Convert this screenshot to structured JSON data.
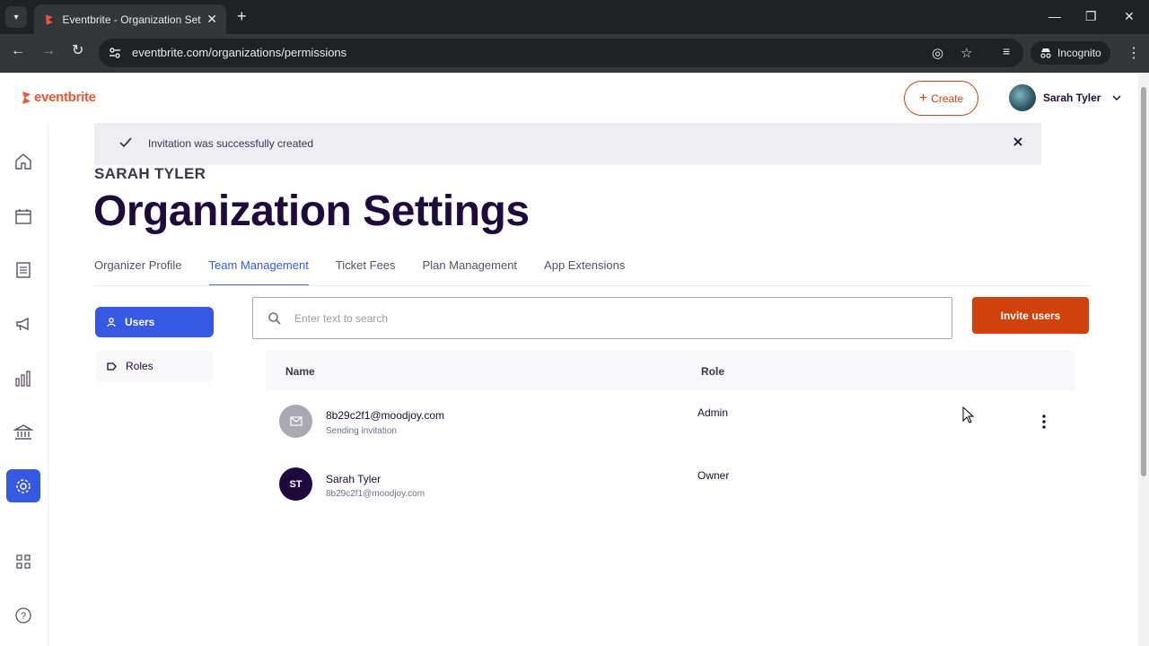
{
  "browser": {
    "tab_title": "Eventbrite - Organization Settings",
    "url": "eventbrite.com/organizations/permissions",
    "incognito_label": "Incognito"
  },
  "header": {
    "logo_text": "eventbrite",
    "create_label": "Create",
    "user_name": "Sarah Tyler"
  },
  "toast": {
    "message": "Invitation was successfully created"
  },
  "page": {
    "org_name": "SARAH TYLER",
    "title": "Organization Settings"
  },
  "tabs": [
    {
      "label": "Organizer Profile"
    },
    {
      "label": "Team Management"
    },
    {
      "label": "Ticket Fees"
    },
    {
      "label": "Plan Management"
    },
    {
      "label": "App Extensions"
    }
  ],
  "sidebar": {
    "users_label": "Users",
    "roles_label": "Roles"
  },
  "search": {
    "placeholder": "Enter text to search",
    "value": ""
  },
  "invite_label": "Invite users",
  "table": {
    "headers": {
      "name": "Name",
      "role": "Role"
    },
    "rows": [
      {
        "primary": "8b29c2f1@moodjoy.com",
        "secondary": "Sending invitation",
        "role": "Admin",
        "avatar": "mail-icon"
      },
      {
        "primary": "Sarah Tyler",
        "secondary": "8b29c2f1@moodjoy.com",
        "role": "Owner",
        "avatar": "ST"
      }
    ]
  },
  "colors": {
    "brand_orange": "#f05537",
    "primary_blue": "#3659e3",
    "invite_red": "#d1410c",
    "title_navy": "#1e0a3c"
  }
}
